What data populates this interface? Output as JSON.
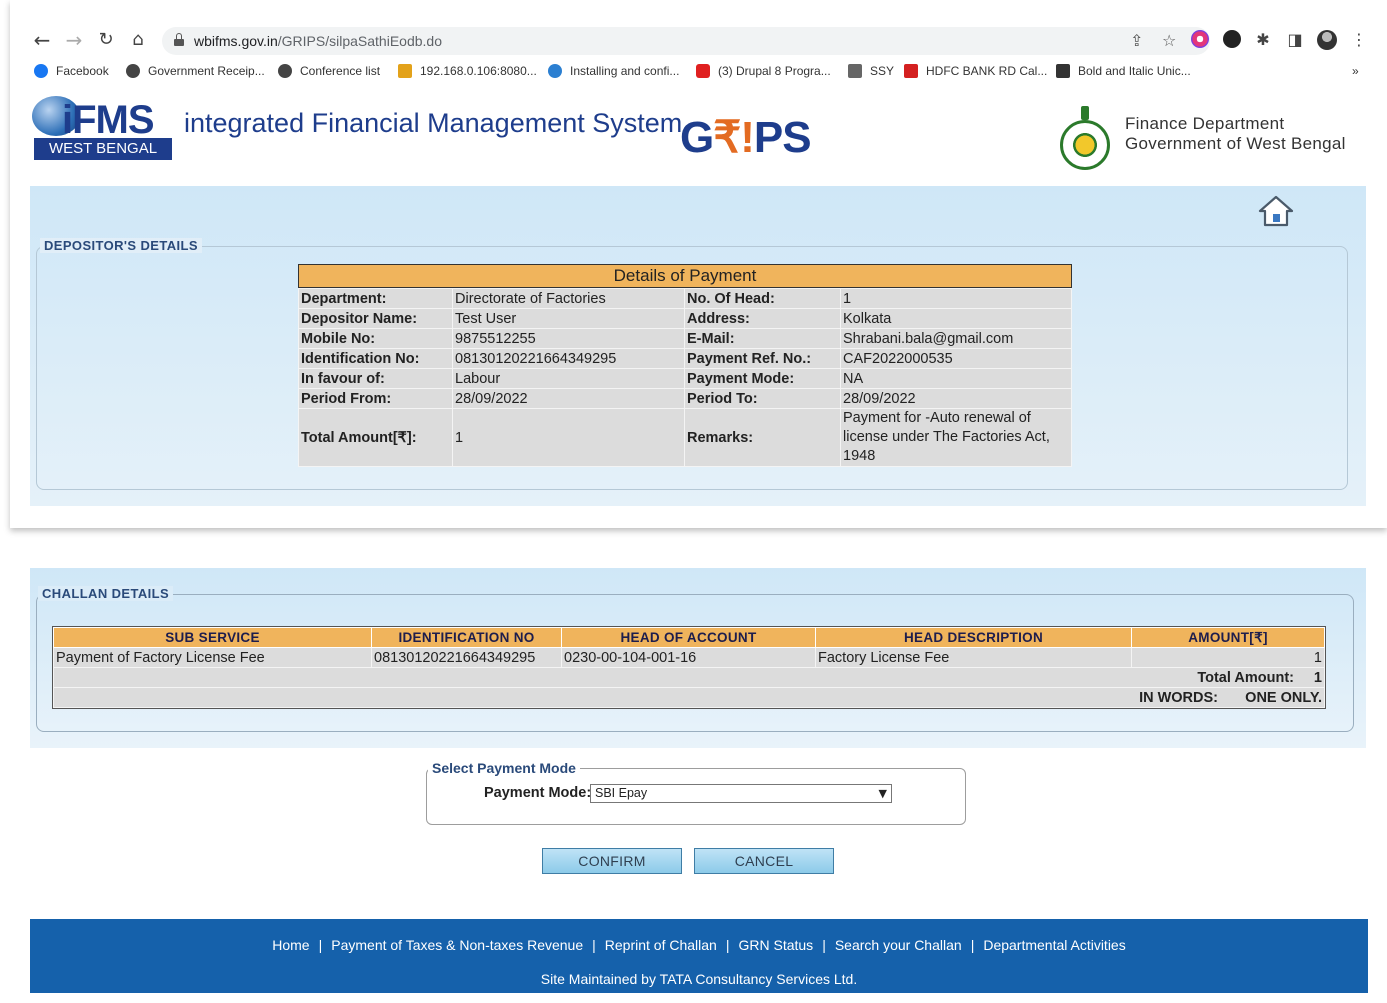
{
  "browser": {
    "url_host": "wbifms.gov.in",
    "url_path": "/GRIPS/silpaSathiEodb.do",
    "bookmarks": [
      {
        "label": "Facebook",
        "color": "#1877f2"
      },
      {
        "label": "Government Receip...",
        "color": "#444444"
      },
      {
        "label": "Conference list",
        "color": "#444444"
      },
      {
        "label": "192.168.0.106:8080...",
        "color": "#e3a21a"
      },
      {
        "label": "Installing and confi...",
        "color": "#2b7fd1"
      },
      {
        "label": "(3) Drupal 8 Progra...",
        "color": "#e02020"
      },
      {
        "label": "SSY",
        "color": "#666666"
      },
      {
        "label": "HDFC BANK RD Cal...",
        "color": "#d42020"
      },
      {
        "label": "Bold and Italic Unic...",
        "color": "#333333"
      }
    ],
    "more_bookmarks": "»"
  },
  "header": {
    "logo_text": "iFMS",
    "logo_band": "WEST BENGAL",
    "title": "integrated Financial Management System",
    "grips_left": "G",
    "grips_mid": "₹!",
    "grips_right": "PS",
    "dept_line1": "Finance Department",
    "dept_line2": "Government of West Bengal"
  },
  "depositor": {
    "legend": "DEPOSITOR'S DETAILS",
    "box_title": "Details of Payment",
    "rows": [
      {
        "k1": "Department:",
        "v1": "Directorate of Factories",
        "k2": "No. Of Head:",
        "v2": "1"
      },
      {
        "k1": "Depositor Name:",
        "v1": "Test User",
        "k2": "Address:",
        "v2": "Kolkata"
      },
      {
        "k1": "Mobile No:",
        "v1": "9875512255",
        "k2": "E-Mail:",
        "v2": "Shrabani.bala@gmail.com"
      },
      {
        "k1": "Identification No:",
        "v1": "08130120221664349295",
        "k2": "Payment Ref. No.:",
        "v2": "CAF2022000535"
      },
      {
        "k1": "In favour of:",
        "v1": "Labour",
        "k2": "Payment Mode:",
        "v2": "NA"
      },
      {
        "k1": "Period From:",
        "v1": "28/09/2022",
        "k2": "Period To:",
        "v2": "28/09/2022"
      },
      {
        "k1": "Total Amount[₹]:",
        "v1": "1",
        "k2": "Remarks:",
        "v2": "Payment for -Auto renewal of license under The Factories Act, 1948"
      }
    ]
  },
  "challan": {
    "legend": "CHALLAN DETAILS",
    "headers": [
      "SUB SERVICE",
      "IDENTIFICATION NO",
      "HEAD OF ACCOUNT",
      "HEAD DESCRIPTION",
      "AMOUNT[₹]"
    ],
    "row": [
      "Payment of Factory License Fee",
      "08130120221664349295",
      "0230-00-104-001-16",
      "Factory License Fee",
      "1"
    ],
    "total_label": "Total Amount:",
    "total_value": "1",
    "words_label": "IN WORDS:",
    "words_value": "ONE ONLY."
  },
  "payment_mode": {
    "legend": "Select Payment Mode",
    "label": "Payment Mode:",
    "selected": "SBI Epay"
  },
  "buttons": {
    "confirm": "CONFIRM",
    "cancel": "CANCEL"
  },
  "footer": {
    "links": [
      "Home",
      "Payment of Taxes & Non-taxes Revenue",
      "Reprint of Challan",
      "GRN Status",
      "Search your Challan",
      "Departmental Activities"
    ],
    "separator": "|",
    "credit": "Site Maintained by TATA Consultancy Services Ltd."
  },
  "colors": {
    "header_orange": "#f0b45c",
    "footer_blue": "#1561ab",
    "brand_blue": "#1e3d8c"
  }
}
